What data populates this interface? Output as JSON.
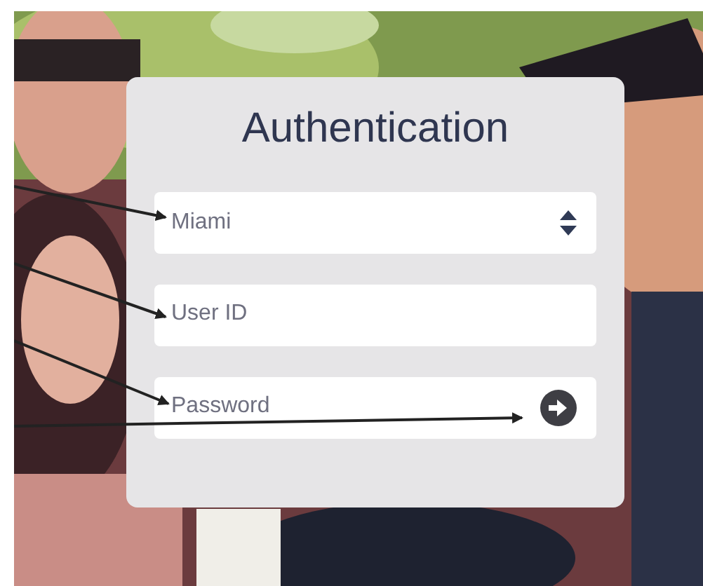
{
  "login_card": {
    "title": "Authentication",
    "fields": [
      {
        "kind": "select",
        "value": "Miami"
      },
      {
        "kind": "text",
        "placeholder": "User ID"
      },
      {
        "kind": "password",
        "placeholder": "Password"
      }
    ]
  }
}
